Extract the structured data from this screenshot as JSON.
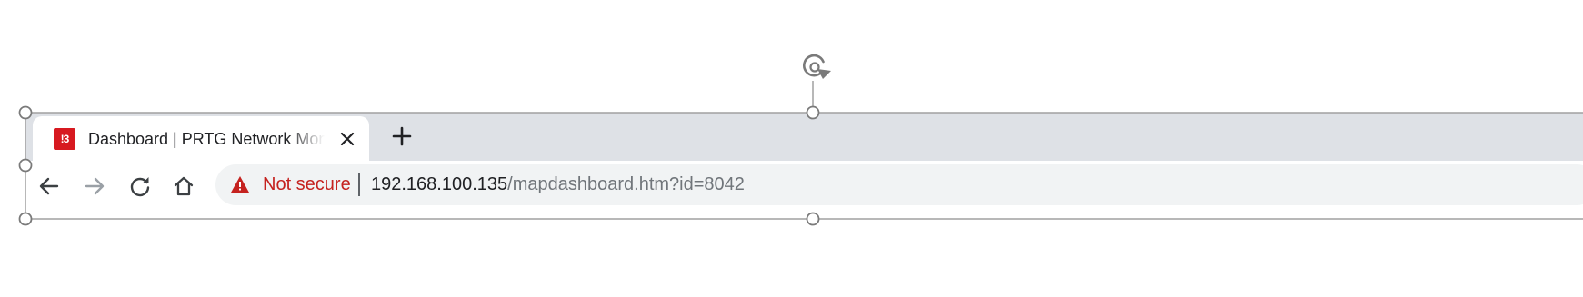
{
  "browser": {
    "tab": {
      "title": "Dashboard | PRTG Network Monitor",
      "favicon_text": "!3",
      "favicon_color": "#d71920"
    },
    "toolbar": {
      "security_label": "Not secure",
      "url_host": "192.168.100.135",
      "url_path": "/mapdashboard.htm?id=8042"
    },
    "icons": {
      "back": "arrow-left-icon",
      "forward": "arrow-right-icon",
      "reload": "reload-icon",
      "home": "home-icon",
      "close": "close-icon",
      "new_tab": "plus-icon",
      "warning": "warning-triangle-icon",
      "rotate": "rotate-handle-icon"
    }
  },
  "colors": {
    "tabstrip": "#dee1e6",
    "omnibox": "#f1f3f4",
    "not_secure": "#c5221f",
    "url_host": "#202124",
    "url_path": "#70757a",
    "selection_line": "#a0a0a0"
  }
}
